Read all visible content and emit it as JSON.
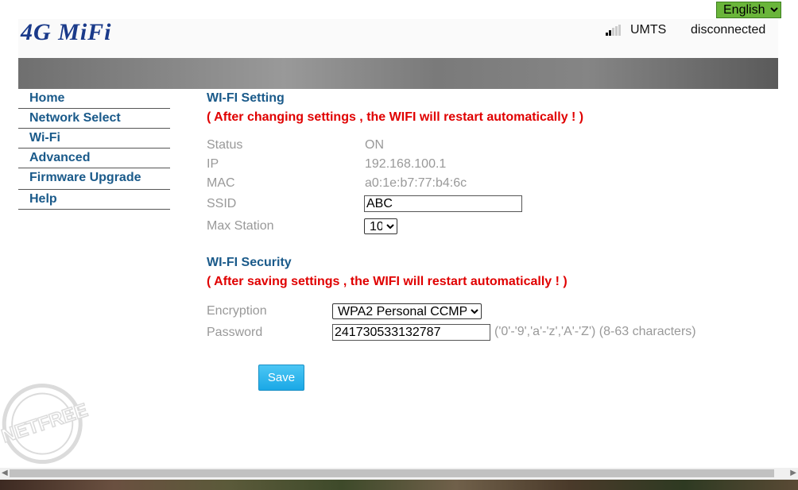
{
  "language": {
    "selected": "English"
  },
  "header": {
    "logo_text": "4G MiFi",
    "network_type": "UMTS",
    "connection_status": "disconnected"
  },
  "nav": {
    "items": [
      {
        "label": "Home"
      },
      {
        "label": "Network Select"
      },
      {
        "label": "Wi-Fi"
      },
      {
        "label": "Advanced"
      },
      {
        "label": "Firmware Upgrade"
      },
      {
        "label": "Help"
      }
    ]
  },
  "wifi_setting": {
    "title": "WI-FI Setting",
    "warning": "( After changing settings , the WIFI will restart automatically ! )",
    "status_label": "Status",
    "status_value": "ON",
    "ip_label": "IP",
    "ip_value": "192.168.100.1",
    "mac_label": "MAC",
    "mac_value": "a0:1e:b7:77:b4:6c",
    "ssid_label": "SSID",
    "ssid_value": "ABC",
    "max_station_label": "Max Station",
    "max_station_value": "10"
  },
  "wifi_security": {
    "title": "WI-FI Security",
    "warning": "( After saving settings , the WIFI will restart automatically ! )",
    "encryption_label": "Encryption",
    "encryption_value": "WPA2 Personal CCMP",
    "password_label": "Password",
    "password_value": "241730533132787",
    "password_hint": "('0'-'9','a'-'z','A'-'Z') (8-63 characters)"
  },
  "save_button_label": "Save",
  "stamp": {
    "text": "NETFREE"
  },
  "colors": {
    "accent": "#1a5a8a",
    "warning": "#e00000",
    "language_bg": "#6ab53a",
    "save_button": "#1aa8e6"
  }
}
